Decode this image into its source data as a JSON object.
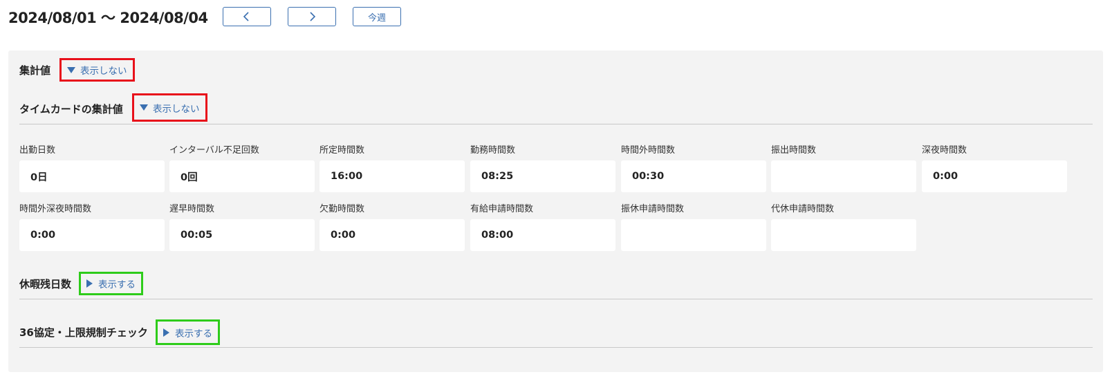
{
  "header": {
    "date_range": "2024/08/01 〜 2024/08/04",
    "prev_icon": "chevron-left-icon",
    "next_icon": "chevron-right-icon",
    "this_week_label": "今週"
  },
  "summary": {
    "title": "集計値",
    "toggle_label": "表示しない"
  },
  "timecard": {
    "title": "タイムカードの集計値",
    "toggle_label": "表示しない",
    "fields": [
      {
        "label": "出勤日数",
        "value": "0日"
      },
      {
        "label": "インターバル不足回数",
        "value": "0回"
      },
      {
        "label": "所定時間数",
        "value": "16:00"
      },
      {
        "label": "勤務時間数",
        "value": "08:25"
      },
      {
        "label": "時間外時間数",
        "value": "00:30"
      },
      {
        "label": "振出時間数",
        "value": ""
      },
      {
        "label": "深夜時間数",
        "value": "0:00"
      },
      {
        "label": "時間外深夜時間数",
        "value": "0:00"
      },
      {
        "label": "遅早時間数",
        "value": "00:05"
      },
      {
        "label": "欠勤時間数",
        "value": "0:00"
      },
      {
        "label": "有給申請時間数",
        "value": "08:00"
      },
      {
        "label": "振休申請時間数",
        "value": ""
      },
      {
        "label": "代休申請時間数",
        "value": ""
      }
    ]
  },
  "leave_balance": {
    "title": "休暇残日数",
    "toggle_label": "表示する"
  },
  "agreement36": {
    "title": "36協定・上限規制チェック",
    "toggle_label": "表示する"
  },
  "colors": {
    "accent": "#3a6fb0",
    "highlight_red": "#e8101a",
    "highlight_green": "#2ecc1a",
    "panel_bg": "#f3f3f3"
  }
}
